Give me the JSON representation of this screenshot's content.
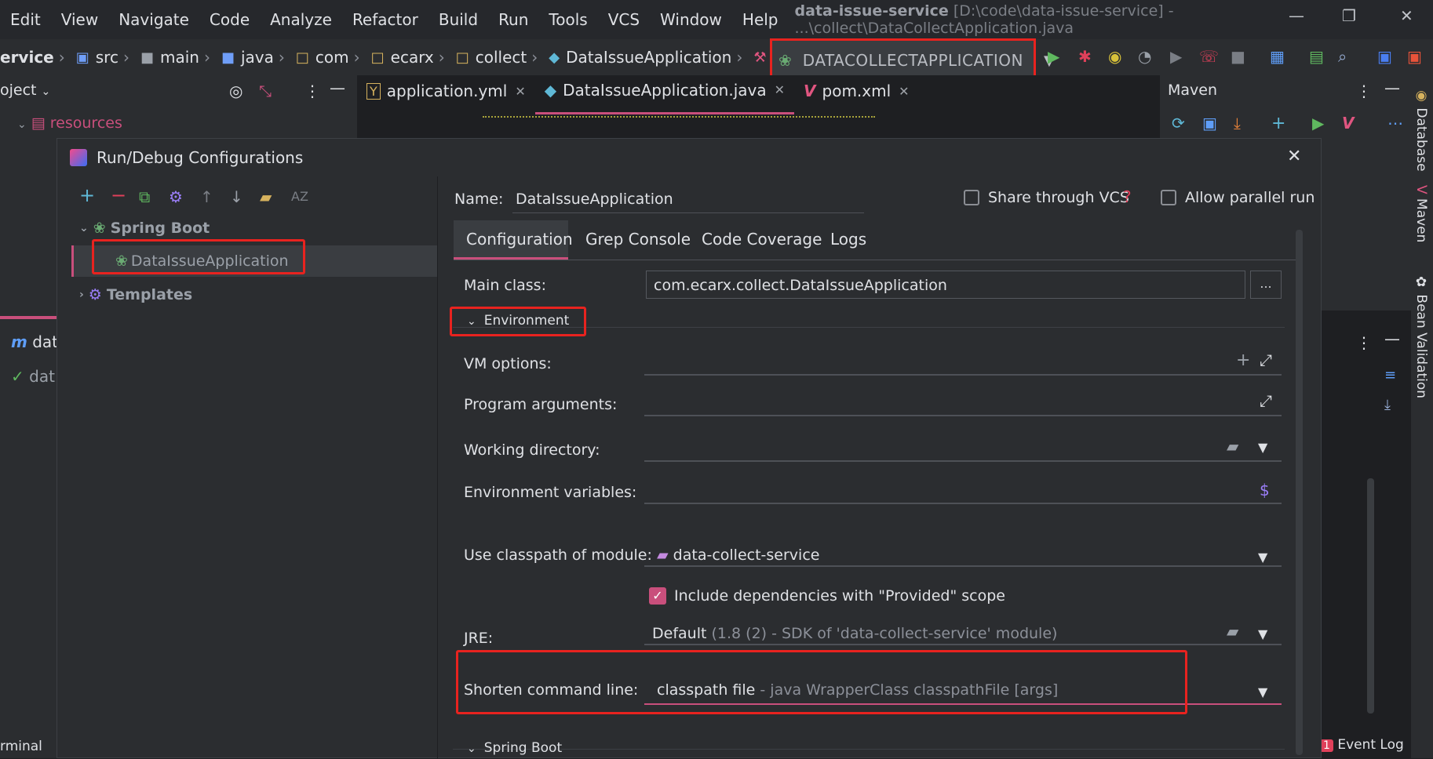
{
  "menu": [
    "Edit",
    "View",
    "Navigate",
    "Code",
    "Analyze",
    "Refactor",
    "Build",
    "Run",
    "Tools",
    "VCS",
    "Window",
    "Help"
  ],
  "window_title": {
    "project": "data-issue-service",
    "path": "[D:\\code\\data-issue-service] - ...\\collect\\DataCollectApplication.java"
  },
  "breadcrumb": [
    "ervice",
    "src",
    "main",
    "java",
    "com",
    "ecarx",
    "collect",
    "DataIssueApplication"
  ],
  "run_config": {
    "label": "DATACOLLECTAPPLICATION"
  },
  "project_panel": {
    "title": "oject",
    "resources": "resources",
    "dat1": "dat",
    "dat2": "dat",
    "terminal": "rminal"
  },
  "editor_tabs": [
    {
      "label": "application.yml"
    },
    {
      "label": "DataIssueApplication.java"
    },
    {
      "label": "pom.xml"
    }
  ],
  "maven": {
    "title": "Maven"
  },
  "side_tabs": [
    "Database",
    "Maven",
    "Bean Validation"
  ],
  "event_log": {
    "count": "1",
    "label": "Event Log"
  },
  "dialog": {
    "title": "Run/Debug Configurations",
    "tree": {
      "spring_boot": "Spring Boot",
      "config": "DataIssueApplication",
      "templates": "Templates"
    },
    "name_label": "Name:",
    "name_value": "DataIssueApplication",
    "share_vcs": "Share through VCS",
    "allow_parallel": "Allow parallel run",
    "tabs": [
      "Configuration",
      "Grep Console",
      "Code Coverage",
      "Logs"
    ],
    "main_class_label": "Main class:",
    "main_class_value": "com.ecarx.collect.DataIssueApplication",
    "environment": "Environment",
    "vm_options": "VM options:",
    "program_args": "Program arguments:",
    "working_dir": "Working directory:",
    "env_vars": "Environment variables:",
    "classpath_label": "Use classpath of module:",
    "classpath_value": "data-collect-service",
    "include_deps": "Include dependencies with \"Provided\" scope",
    "jre_label": "JRE:",
    "jre_value": "Default",
    "jre_hint": "(1.8 (2) - SDK of 'data-collect-service' module)",
    "shorten_label": "Shorten command line:",
    "shorten_value": "classpath file",
    "shorten_hint": "- java WrapperClass classpathFile [args]",
    "spring_boot_section": "Spring Boot",
    "browse": "..."
  },
  "colors": {
    "accent_red": "#e8231f",
    "spring_green": "#6aab73",
    "pink": "#c94f7c"
  }
}
